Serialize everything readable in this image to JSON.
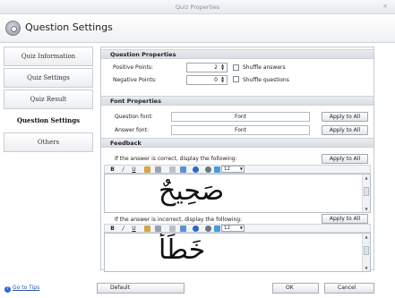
{
  "window": {
    "title": "Quiz Properties",
    "close_glyph": "×"
  },
  "header": {
    "title": "Question Settings",
    "icon": "gear-icon"
  },
  "sidebar": {
    "items": [
      {
        "label": "Quiz Information"
      },
      {
        "label": "Quiz Settings"
      },
      {
        "label": "Quiz Result"
      },
      {
        "label": "Question Settings",
        "active": true
      },
      {
        "label": "Others"
      }
    ]
  },
  "question_properties": {
    "heading": "Question Properties",
    "positive_label": "Positive Points:",
    "positive_value": "2",
    "negative_label": "Negative Points:",
    "negative_value": "0",
    "shuffle_answers": "Shuffle answers",
    "shuffle_questions": "Shuffle questions"
  },
  "font_properties": {
    "heading": "Font Properties",
    "question_font_label": "Question font:",
    "question_font_value": "Font",
    "answer_font_label": "Answer font:",
    "answer_font_value": "Font",
    "apply_label": "Apply to All"
  },
  "feedback": {
    "heading": "Feedback",
    "correct_label": "If the answer is correct, display the following:",
    "incorrect_label": "If the answer is incorrect, display the following:",
    "apply_label": "Apply to All",
    "toolbar": {
      "bold": "B",
      "italic": "/",
      "underline": "U",
      "font_size": "12"
    },
    "correct_text": "صَحِيحٌ",
    "incorrect_text": "خَطَأٌ"
  },
  "footer": {
    "tips_label": "Go to Tips",
    "default_label": "Default",
    "ok_label": "OK",
    "cancel_label": "Cancel"
  },
  "colors": {
    "accent": "#2e66c8",
    "section_header": "#dde1e6",
    "border": "#c5cad0"
  }
}
